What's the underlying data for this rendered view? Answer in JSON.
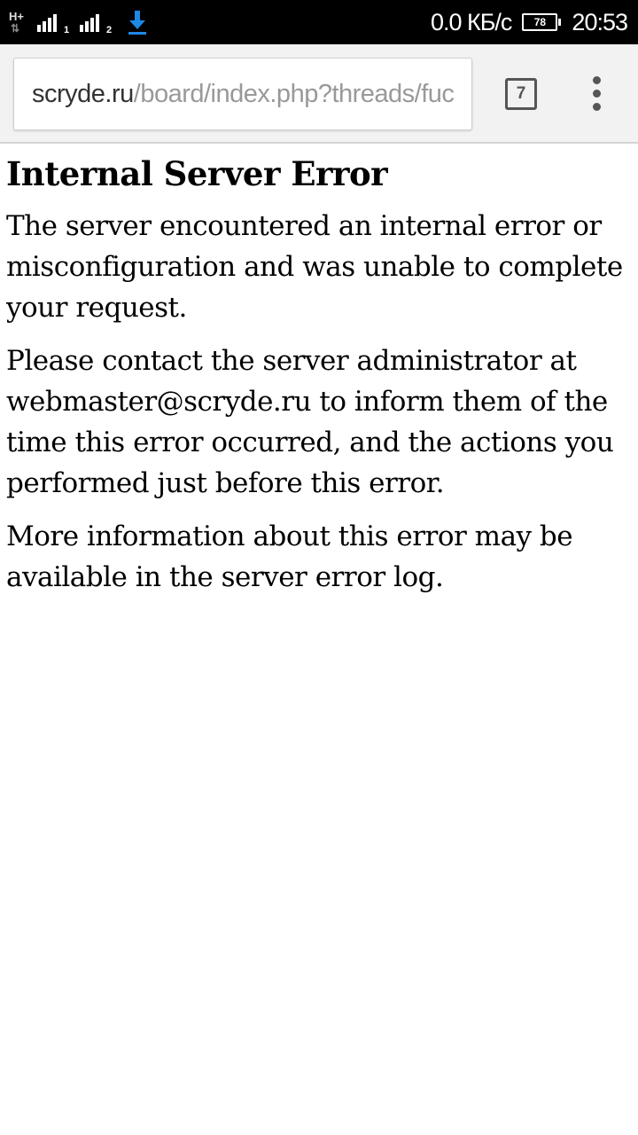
{
  "status_bar": {
    "network_type": "H+",
    "sim1_label": "1",
    "sim2_label": "2",
    "data_speed": "0.0 КБ/с",
    "battery_level": "78",
    "time": "20:53",
    "download_icon_color": "#1e88e5"
  },
  "browser": {
    "url_host": "scryde.ru",
    "url_path": "/board/index.php?threads/fuck",
    "tab_count": "7",
    "menu_icon": "overflow-menu-icon"
  },
  "page": {
    "title": "Internal Server Error",
    "paragraphs": [
      "The server encountered an internal error or misconfiguration and was unable to complete your request.",
      "Please contact the server administrator at webmaster@scryde.ru to inform them of the time this error occurred, and the actions you performed just before this error.",
      "More information about this error may be available in the server error log."
    ]
  }
}
